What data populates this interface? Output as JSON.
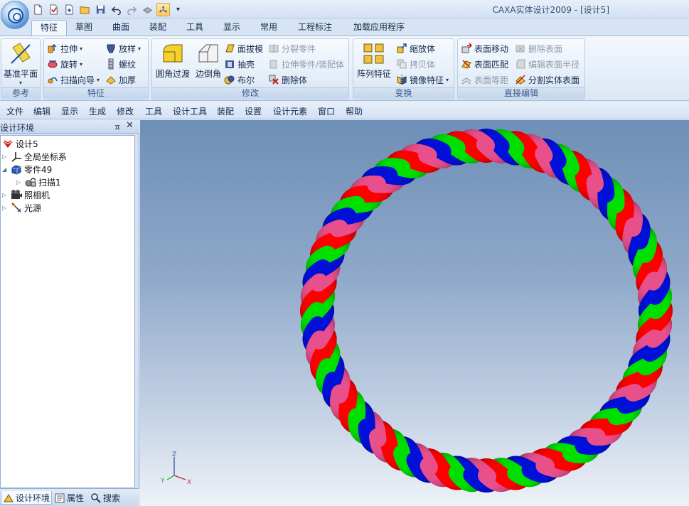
{
  "window": {
    "title": "CAXA实体设计2009 - [设计5]"
  },
  "quick_access": {
    "more": "▾"
  },
  "tabs": [
    "特征",
    "草图",
    "曲面",
    "装配",
    "工具",
    "显示",
    "常用",
    "工程标注",
    "加载应用程序"
  ],
  "ribbon": {
    "reference": {
      "label": "参考",
      "datum_plane": "基准平面"
    },
    "feature": {
      "label": "特征",
      "extrude": "拉伸",
      "revolve": "旋转",
      "sweep_wizard": "扫描向导",
      "loft": "放样",
      "thread": "螺纹",
      "thicken": "加厚"
    },
    "modify": {
      "label": "修改",
      "fillet": "圆角过渡",
      "chamfer": "边倒角",
      "draft": "面拔模",
      "shell": "抽壳",
      "boolean": "布尔",
      "split_part": "分裂零件",
      "extrude_part_assembly": "拉伸零件/装配体",
      "delete_body": "删除体"
    },
    "transform": {
      "label": "变换",
      "array": "阵列特征",
      "scale": "缩放体",
      "copy": "拷贝体",
      "mirror": "镜像特征"
    },
    "direct_edit": {
      "label": "直接编辑",
      "move_face": "表面移动",
      "match_face": "表面匹配",
      "offset_face": "表面等距",
      "delete_face": "删除表面",
      "edit_radius": "编辑表面半径",
      "split_solid_face": "分割实体表面"
    }
  },
  "menu": [
    "文件",
    "编辑",
    "显示",
    "生成",
    "修改",
    "工具",
    "设计工具",
    "装配",
    "设置",
    "设计元素",
    "窗口",
    "帮助"
  ],
  "panel": {
    "title": "设计环境",
    "pin": "ㅍ",
    "close": "✕",
    "tree": [
      "设计5",
      "全局坐标系",
      "零件49",
      "扫描1",
      "照相机",
      "光源"
    ],
    "bottom_tabs": [
      "设计环境",
      "属性",
      "搜索"
    ]
  },
  "viewport": {
    "axes": {
      "x": "X",
      "y": "Y",
      "z": "Z"
    },
    "watermark": "...",
    "strand_colors": [
      "#ff0000",
      "#00e000",
      "#0010d8",
      "#e8508c"
    ]
  }
}
